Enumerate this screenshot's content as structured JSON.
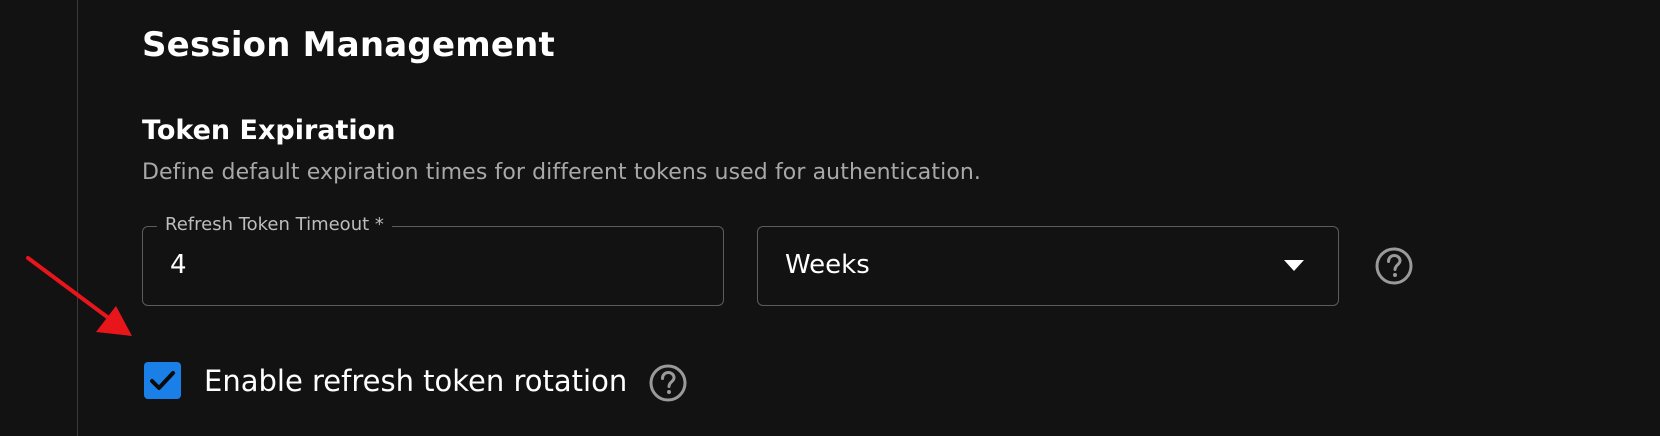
{
  "session": {
    "title": "Session Management"
  },
  "token_expiration": {
    "title": "Token Expiration",
    "description": "Define default expiration times for different tokens used for authentication."
  },
  "refresh_timeout": {
    "label": "Refresh Token Timeout *",
    "value": "4"
  },
  "unit_select": {
    "selected": "Weeks",
    "icon": "chevron-down-icon"
  },
  "rotation": {
    "label": "Enable refresh token rotation",
    "checked": true
  },
  "icons": {
    "help": "help-circle-icon",
    "checkmark": "checkmark-icon",
    "annotation": "red-arrow-icon"
  },
  "colors": {
    "background": "#121212",
    "accent": "#1a7fe6",
    "annotation": "#e8151b"
  }
}
